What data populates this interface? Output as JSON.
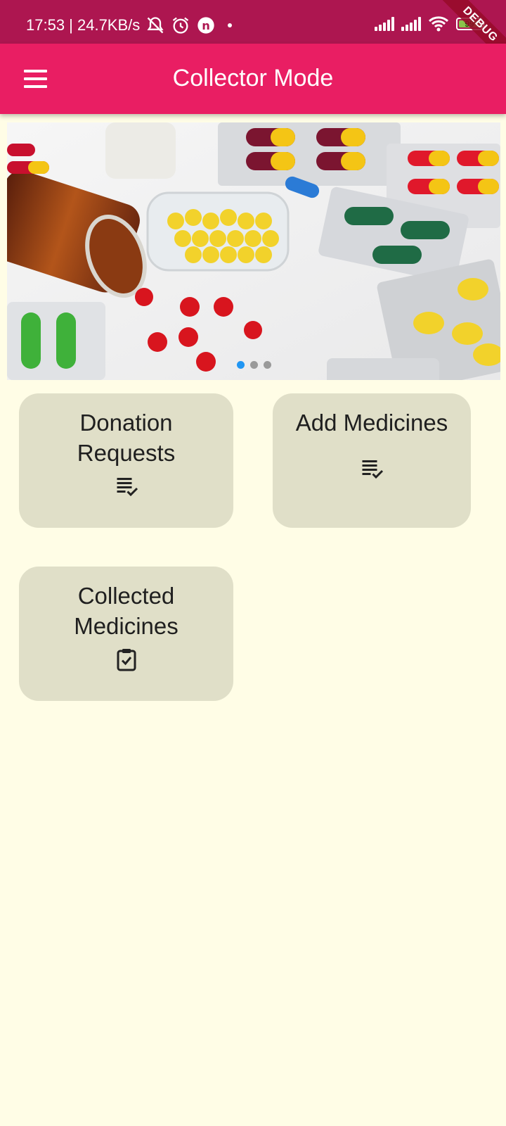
{
  "status_bar": {
    "time_speed": "17:53 | 24.7KB/s",
    "battery_level": "99",
    "icons": [
      "muted-bell-icon",
      "alarm-icon",
      "vpn-icon",
      "dot-icon",
      "signal-icon",
      "signal-icon",
      "wifi-icon",
      "battery-icon"
    ]
  },
  "debug_banner": "DEBUG",
  "app_bar": {
    "title": "Collector Mode",
    "menu_icon": "hamburger-menu-icon"
  },
  "carousel": {
    "slide_count": 3,
    "active_index": 0,
    "image_description": "pills and medicine image"
  },
  "cards": [
    {
      "label": "Donation\nRequests",
      "icon": "list-check-icon"
    },
    {
      "label": "Add Medicines",
      "icon": "list-check-icon"
    },
    {
      "label": "Collected\nMedicines",
      "icon": "clipboard-check-icon"
    }
  ],
  "colors": {
    "status_bar": "#ad1650",
    "app_bar": "#e91e63",
    "background": "#fffde6",
    "card": "#e0dfc8",
    "active_dot": "#2196f3"
  }
}
